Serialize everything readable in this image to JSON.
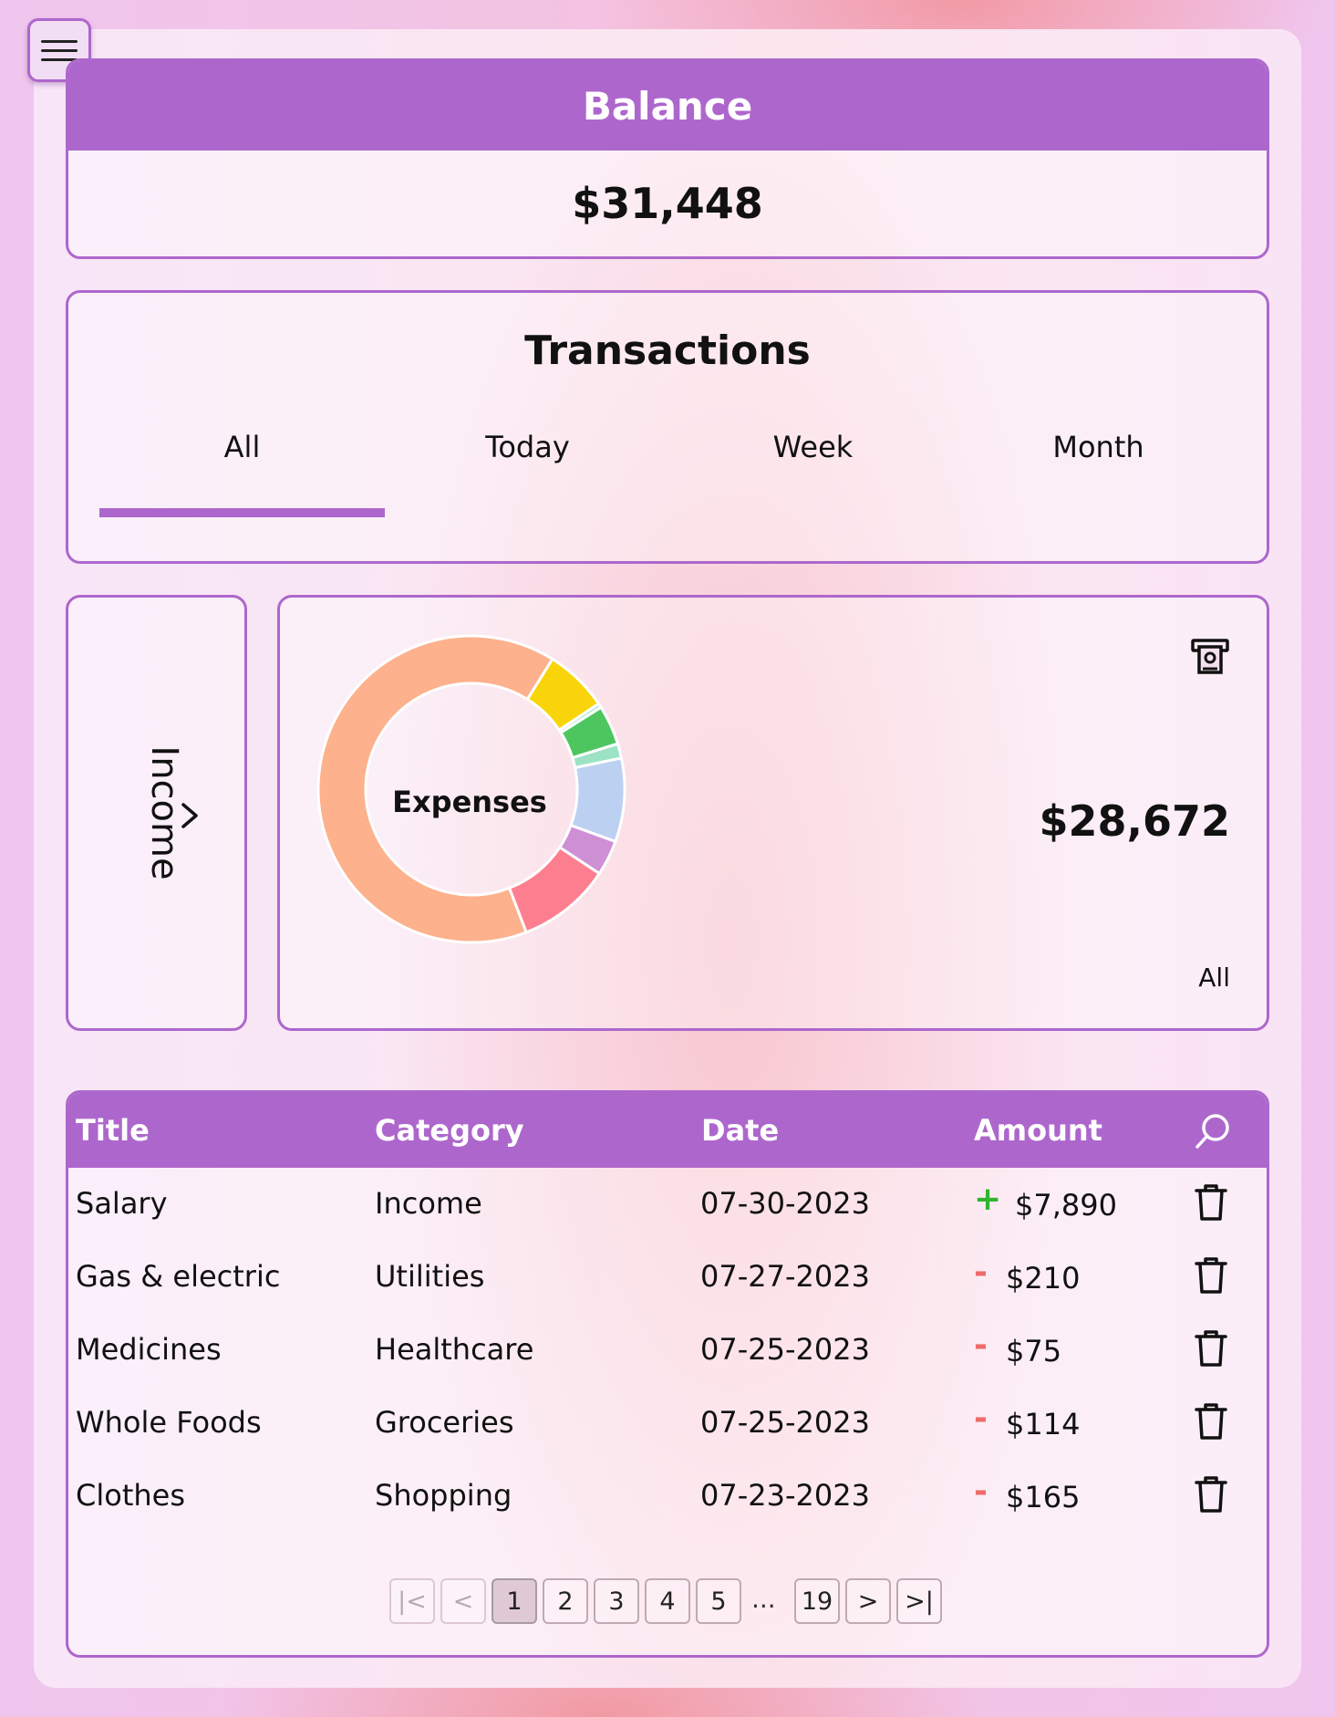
{
  "balance": {
    "title": "Balance",
    "value": "$31,448"
  },
  "transactions": {
    "title": "Transactions",
    "tabs": [
      "All",
      "Today",
      "Week",
      "Month"
    ],
    "active_tab": "All"
  },
  "income_panel": {
    "label": "Income",
    "chevron": "chevron-right-icon"
  },
  "expenses_panel": {
    "center_label": "Expenses",
    "total": "$28,672",
    "period": "All",
    "icon": "atm-icon"
  },
  "chart_data": {
    "type": "pie",
    "title": "Expenses",
    "values": [
      71.3,
      7.4,
      0.5,
      4.6,
      1.7,
      9.7,
      4.1,
      10.9
    ],
    "colors": [
      "#fdb18c",
      "#fad40b",
      "#aee8d6",
      "#4ec660",
      "#9ce3c5",
      "#bcd0f2",
      "#cf8fd5",
      "#fd7f8f"
    ]
  },
  "table": {
    "headers": {
      "title": "Title",
      "category": "Category",
      "date": "Date",
      "amount": "Amount"
    },
    "search_icon": "search-icon",
    "rows": [
      {
        "title": "Salary",
        "category": "Income",
        "date": "07-30-2023",
        "sign": "+",
        "amount": "$7,890",
        "type": "income"
      },
      {
        "title": "Gas & electric",
        "category": "Utilities",
        "date": "07-27-2023",
        "sign": "-",
        "amount": "$210",
        "type": "expense"
      },
      {
        "title": "Medicines",
        "category": "Healthcare",
        "date": "07-25-2023",
        "sign": "-",
        "amount": "$75",
        "type": "expense"
      },
      {
        "title": "Whole Foods",
        "category": "Groceries",
        "date": "07-25-2023",
        "sign": "-",
        "amount": "$114",
        "type": "expense"
      },
      {
        "title": "Clothes",
        "category": "Shopping",
        "date": "07-23-2023",
        "sign": "-",
        "amount": "$165",
        "type": "expense"
      }
    ]
  },
  "pagination": {
    "first": "|<",
    "prev": "<",
    "pages": [
      "1",
      "2",
      "3",
      "4",
      "5"
    ],
    "ellipsis": "...",
    "last_page": "19",
    "next": ">",
    "last": ">|",
    "current": "1"
  },
  "colors": {
    "accent": "#ad67cc",
    "income": "#2fb52f",
    "expense": "#f06a6a"
  }
}
